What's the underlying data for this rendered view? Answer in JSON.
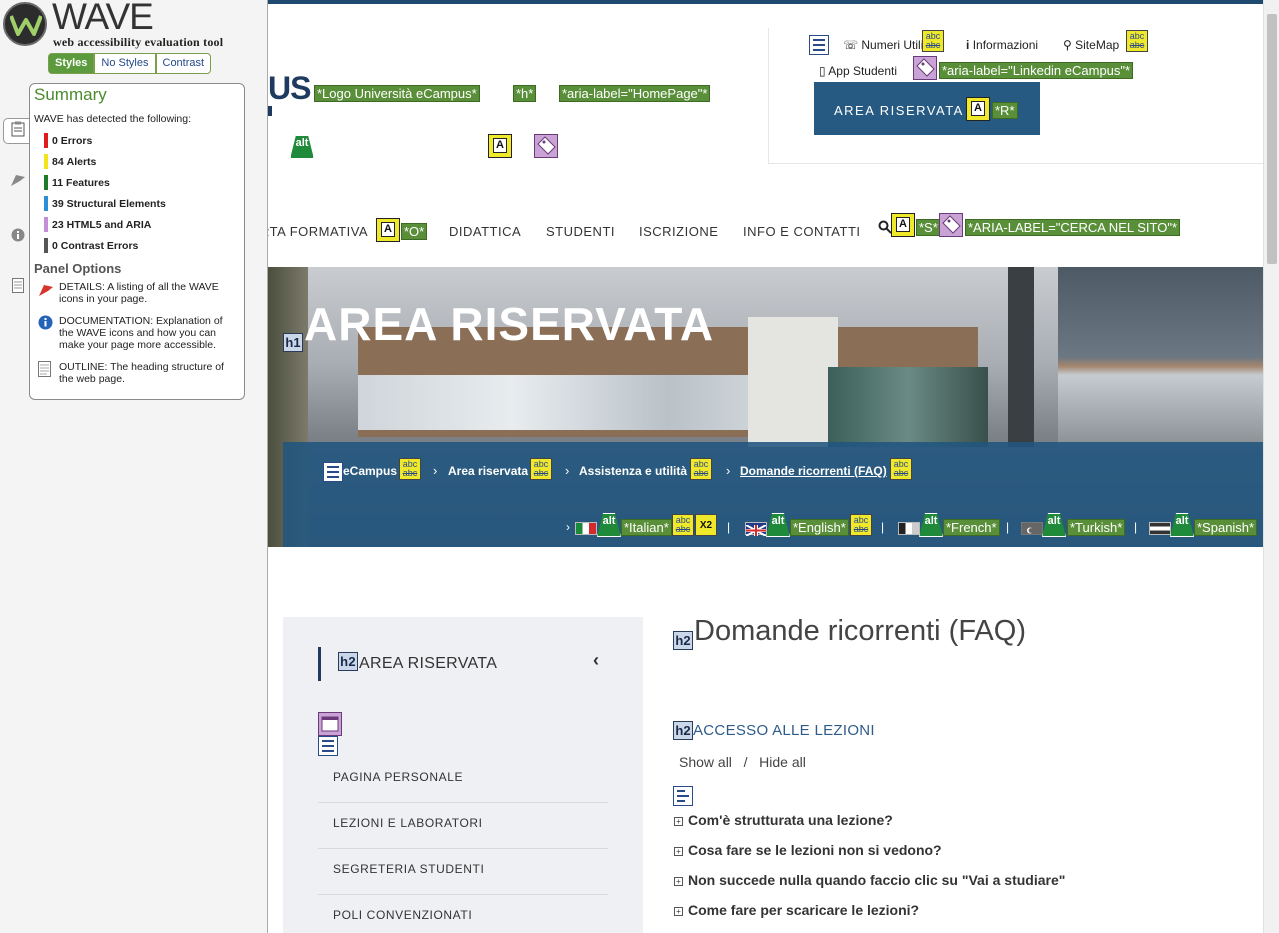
{
  "wave": {
    "logo_word": "WAVE",
    "logo_sub": "web accessibility evaluation tool",
    "style_tabs": [
      "Styles",
      "No Styles",
      "Contrast"
    ],
    "summary_title": "Summary",
    "summary_intro": "WAVE has detected the following:",
    "summary_items": [
      {
        "count": "0",
        "label": "Errors",
        "color": "#e01b1b"
      },
      {
        "count": "84",
        "label": "Alerts",
        "color": "#f5e31a"
      },
      {
        "count": "11",
        "label": "Features",
        "color": "#1e7a26"
      },
      {
        "count": "39",
        "label": "Structural Elements",
        "color": "#2a8fd6"
      },
      {
        "count": "23",
        "label": "HTML5 and ARIA",
        "color": "#c48ed9"
      },
      {
        "count": "0",
        "label": "Contrast Errors",
        "color": "#555555"
      }
    ],
    "panel_options_title": "Panel Options",
    "options": [
      {
        "text": "DETAILS: A listing of all the WAVE icons in your page.",
        "icon": "flag-icon"
      },
      {
        "text": "DOCUMENTATION: Explanation of the WAVE icons and how you can make your page more accessible.",
        "icon": "info-icon"
      },
      {
        "text": "OUTLINE: The heading structure of the web page.",
        "icon": "document-icon"
      }
    ]
  },
  "header": {
    "logo_fragment": "US",
    "annotations": {
      "logo": "*Logo Università eCampus*",
      "h": "*h*",
      "homepage": "*aria-label=\"HomePage\"*",
      "linkedin": "*aria-label=\"Linkedin eCampus\"*",
      "r": "*R*",
      "o": "*O*",
      "s": "*S*",
      "search": "*ARIA-LABEL=\"CERCA NEL SITO\"*"
    },
    "utility_links": [
      "Numeri Utili",
      "Informazioni",
      "SiteMap",
      "App Studenti"
    ],
    "area_button": "AREA RISERVATA",
    "nav": [
      "RTA FORMATIVA",
      "DIDATTICA",
      "STUDENTI",
      "ISCRIZIONE",
      "INFO E CONTATTI"
    ]
  },
  "hero": {
    "title": "AREA RISERVATA",
    "breadcrumb": [
      "eCampus",
      "Area riservata",
      "Assistenza e utilità",
      "Domande ricorrenti (FAQ)"
    ],
    "languages": [
      "*Italian*",
      "*English*",
      "*French*",
      "*Turkish*",
      "*Spanish*"
    ]
  },
  "sidenav": {
    "title": "AREA RISERVATA",
    "items": [
      "PAGINA PERSONALE",
      "LEZIONI E LABORATORI",
      "SEGRETERIA STUDENTI",
      "POLI CONVENZIONATI"
    ]
  },
  "content": {
    "title": "Domande ricorrenti (FAQ)",
    "section": "ACCESSO ALLE LEZIONI",
    "show_all": "Show all",
    "sep": "/",
    "hide_all": "Hide all",
    "faqs": [
      "Com'è strutturata una lezione?",
      "Cosa fare se le lezioni non si vedono?",
      "Non succede nulla quando faccio clic su \"Vai a studiare\"",
      "Come fare per scaricare le lezioni?"
    ]
  },
  "icon_labels": {
    "abc_top": "abc",
    "abc_bottom": "abc",
    "alt": "alt",
    "a": "A",
    "h1": "h1",
    "h2": "h2",
    "x2": "X2"
  }
}
